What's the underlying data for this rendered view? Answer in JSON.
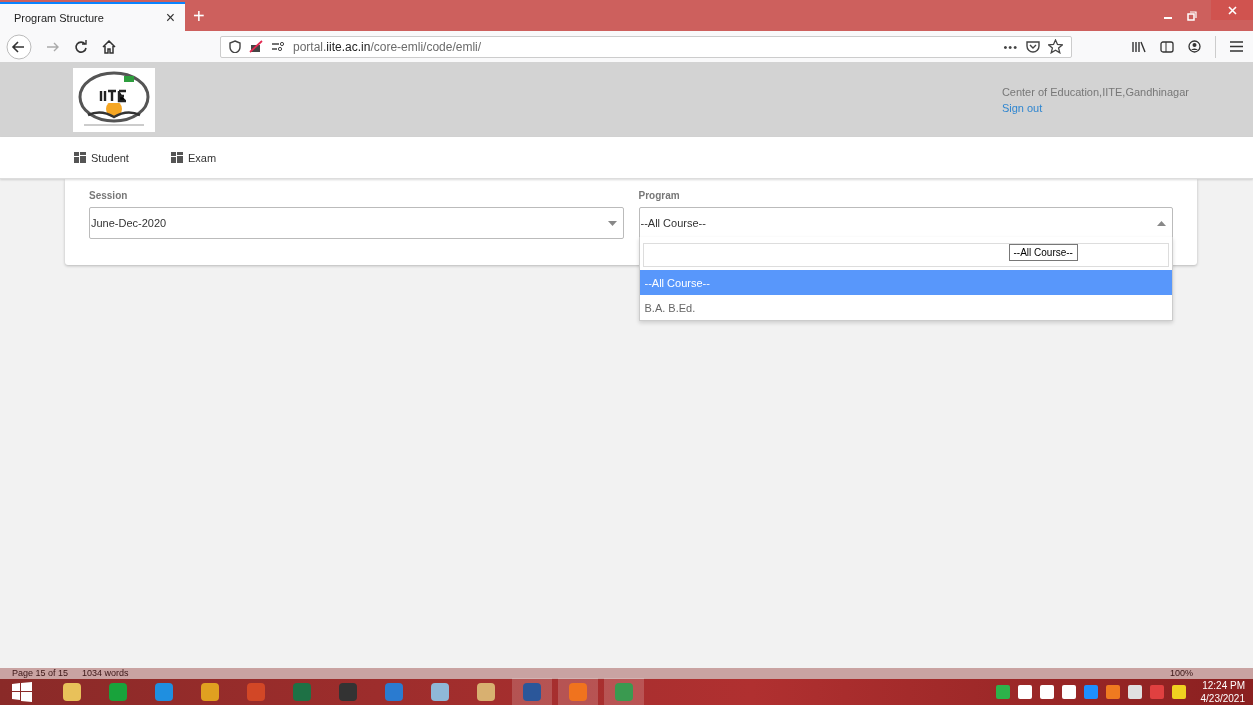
{
  "browser": {
    "tab_title": "Program Structure",
    "tab_close": "×",
    "new_tab": "+",
    "url": "portal.**iite.ac.in**/core-emli/code/emli/",
    "more": "•••"
  },
  "header": {
    "org": "Center of Education,IITE,Gandhinagar",
    "sign_out": "Sign out"
  },
  "menu": [
    {
      "label": "Student"
    },
    {
      "label": "Exam"
    }
  ],
  "form": {
    "session": {
      "label": "Session",
      "value": "June-Dec-2020",
      "expanded": false
    },
    "program": {
      "label": "Program",
      "value": "--All Course--",
      "expanded": true,
      "tooltip": "--All Course--",
      "options": [
        {
          "label": "--All Course--",
          "selected": true
        },
        {
          "label": "B.A. B.Ed.",
          "selected": false
        }
      ]
    }
  },
  "taskbar": {
    "status_text": [
      "Page 15 of 15",
      "1034 words"
    ],
    "zoom": "100%",
    "time": "12:24 PM",
    "date": "4/23/2021"
  }
}
